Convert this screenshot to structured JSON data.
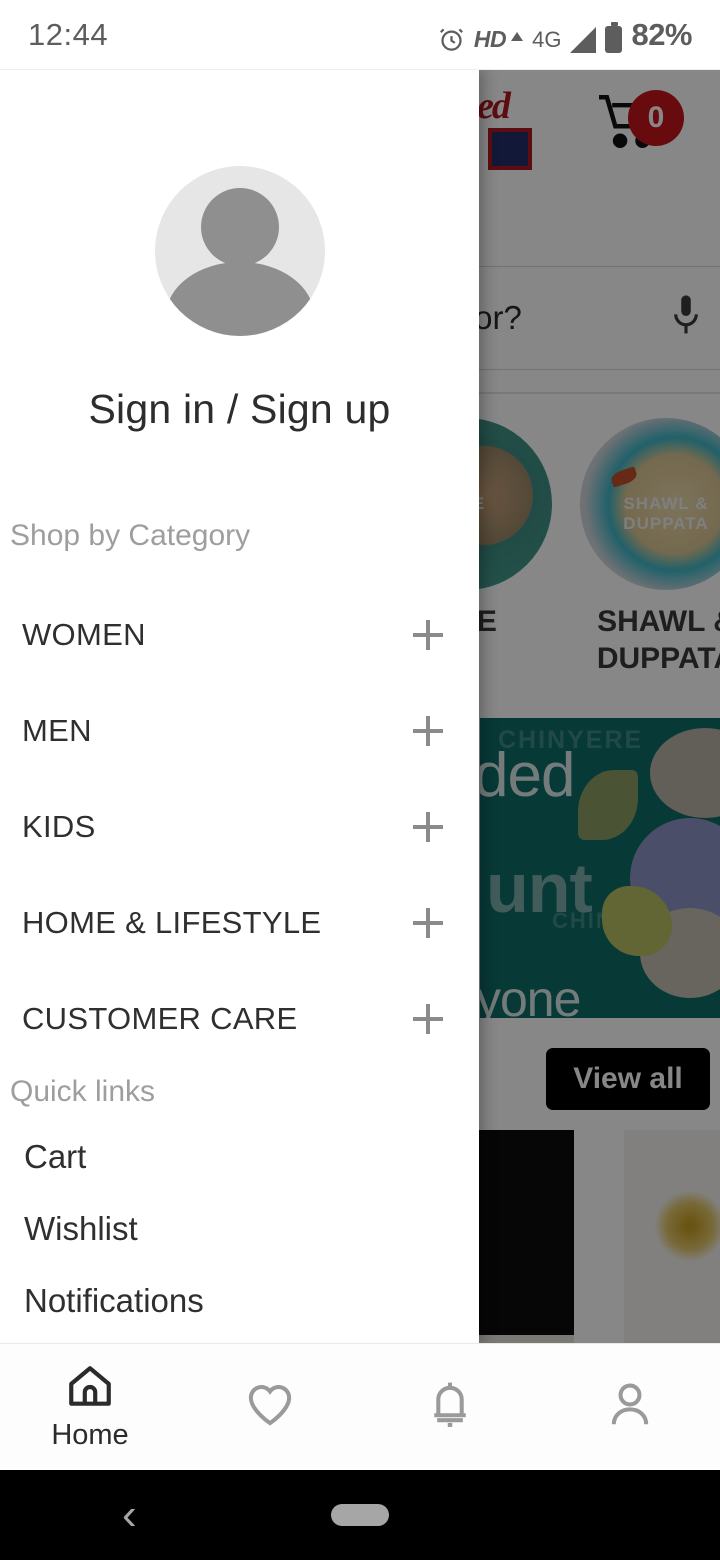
{
  "status_bar": {
    "time": "12:44",
    "alarm_icon": "alarm-clock-icon",
    "hd_label": "HD",
    "network_label": "4G",
    "signal_icon": "signal-bars-icon",
    "battery_icon": "battery-icon",
    "battery_percent": "82%"
  },
  "app_background": {
    "logo_fragment": "ed",
    "cart": {
      "icon": "shopping-cart-icon",
      "badge_count": "0"
    },
    "search": {
      "visible_text": "for?",
      "placeholder": "What are you looking for?",
      "mic_icon": "microphone-icon"
    },
    "categories": [
      {
        "label": "ECE",
        "overlay_text": "ECE"
      },
      {
        "label": "SHAWL & DUPPATA",
        "overlay_text": "SHAWL & DUPPATA"
      }
    ],
    "banner": {
      "brand": "CHINYERE",
      "text_fragments": [
        "ded",
        "unt",
        "yone"
      ],
      "accent_color": "#0f6d68"
    },
    "view_all_label": "View all",
    "products": [
      {
        "name": "product-card-dark"
      },
      {
        "name": "product-card-light"
      }
    ]
  },
  "drawer": {
    "avatar_icon": "user-avatar-icon",
    "sign_in_label": "Sign in / Sign up",
    "shop_section_title": "Shop by Category",
    "categories": [
      {
        "label": "WOMEN",
        "expander": "+"
      },
      {
        "label": "MEN",
        "expander": "+"
      },
      {
        "label": "KIDS",
        "expander": "+"
      },
      {
        "label": "HOME & LIFESTYLE",
        "expander": "+"
      },
      {
        "label": "CUSTOMER CARE",
        "expander": "+"
      }
    ],
    "quick_section_title": "Quick links",
    "quick_links": [
      {
        "label": "Cart"
      },
      {
        "label": "Wishlist"
      },
      {
        "label": "Notifications"
      }
    ]
  },
  "bottom_nav": {
    "items": [
      {
        "label": "Home",
        "icon": "home-icon",
        "active": true
      },
      {
        "label": "",
        "icon": "heart-icon",
        "active": false
      },
      {
        "label": "",
        "icon": "bell-icon",
        "active": false
      },
      {
        "label": "",
        "icon": "person-icon",
        "active": false
      }
    ]
  },
  "android_nav": {
    "back_icon": "chevron-left-icon",
    "home_pill_icon": "home-pill-icon"
  },
  "colors": {
    "brand_red": "#b01920",
    "badge_red": "#c2161d",
    "banner_teal": "#0f6d68",
    "button_black": "#000000",
    "muted_gray": "#9e9e9e"
  }
}
